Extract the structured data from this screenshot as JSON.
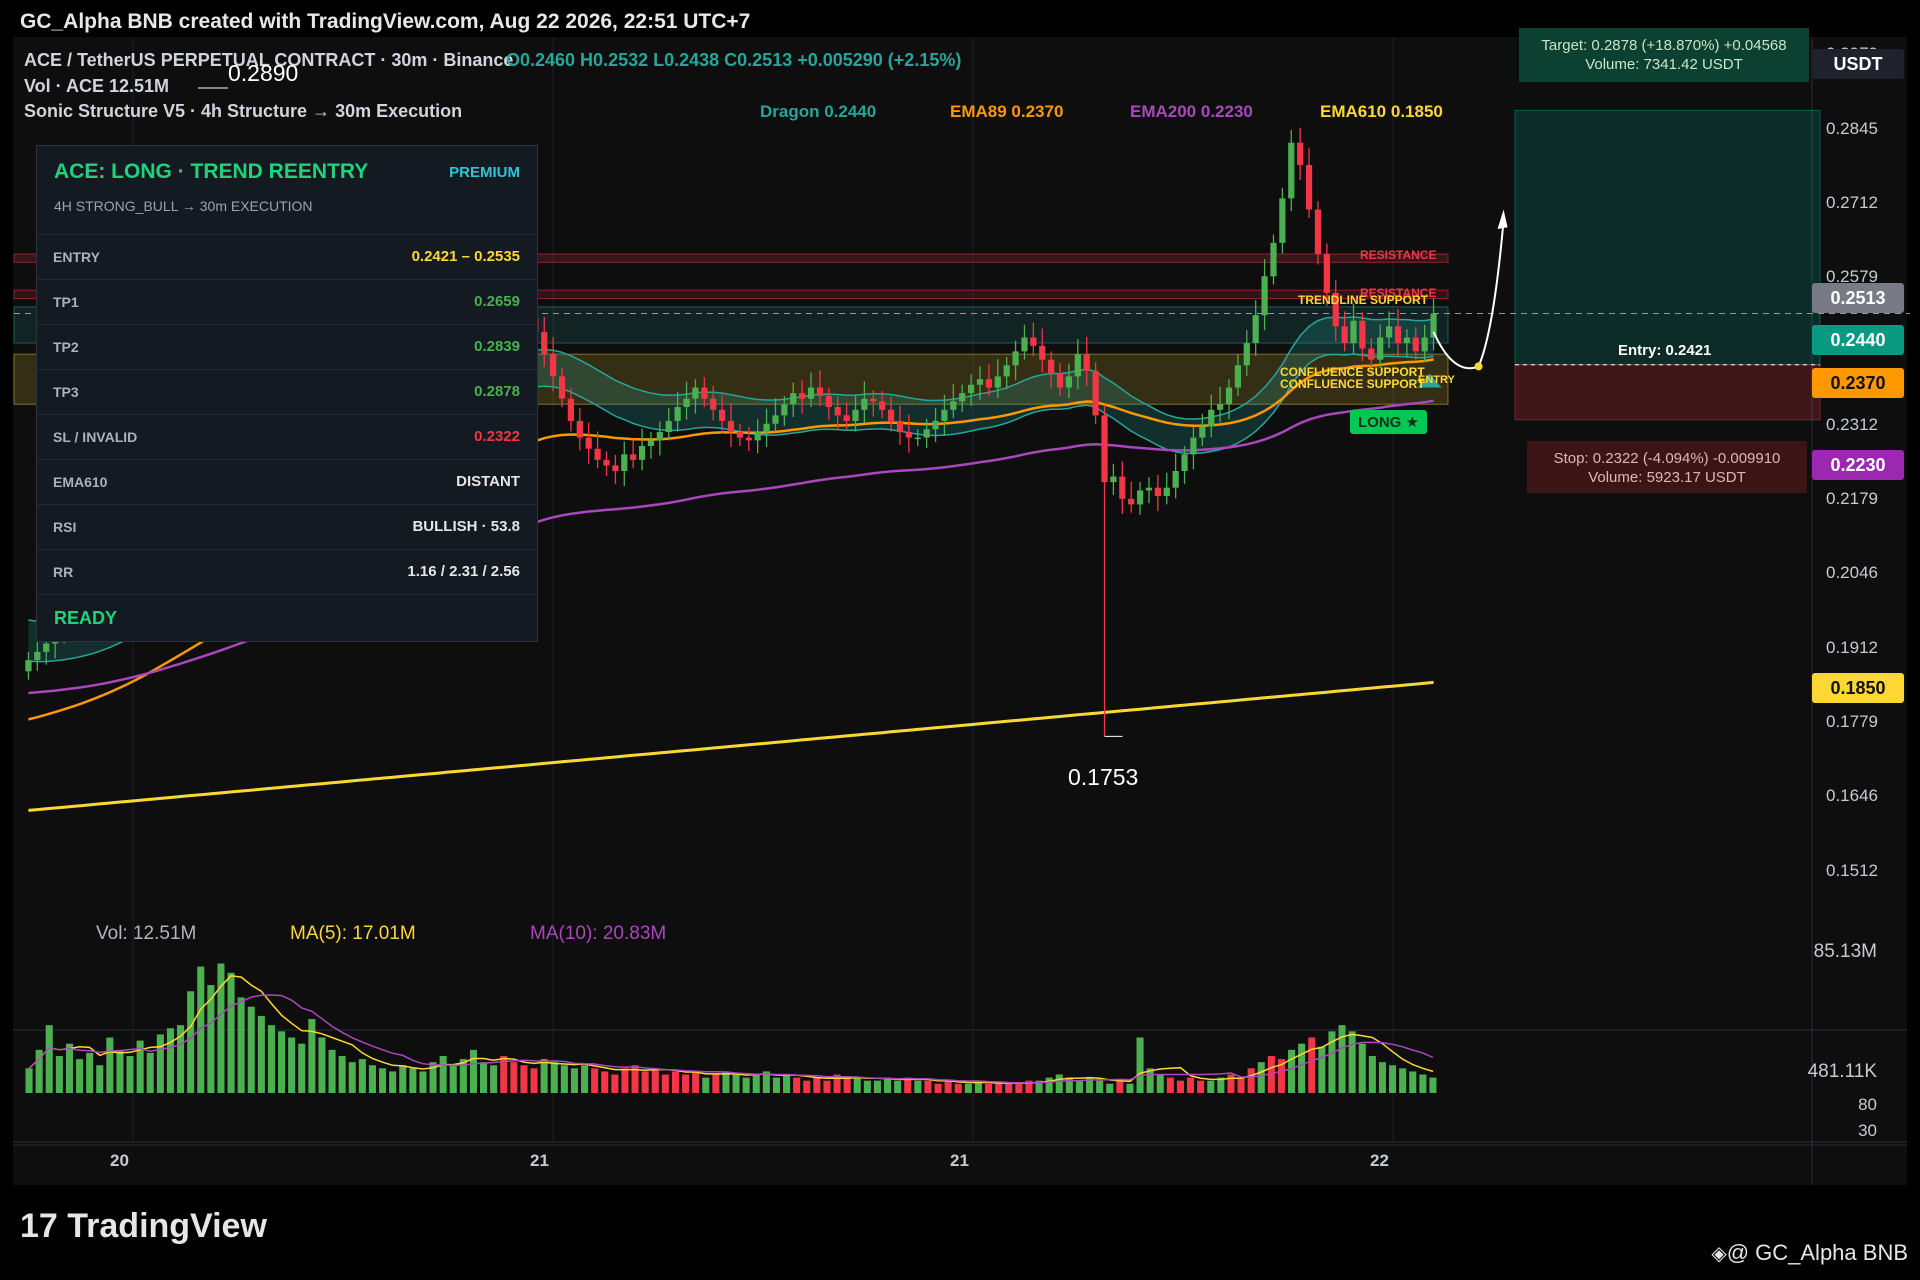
{
  "header": {
    "title": "GC_Alpha BNB created with TradingView.com, Aug 22 2026, 22:51 UTC+7"
  },
  "legend": {
    "symbol": "ACE / TetherUS PERPETUAL CONTRACT · 30m · Binance",
    "ohlc": "O0.2460 H0.2532 L0.2438 C0.2513 +0.005290 (+2.15%)",
    "vol": "Vol · ACE  12.51M",
    "indicator": "Sonic Structure V5 · 4h Structure → 30m Execution"
  },
  "indicators": [
    {
      "label": "Dragon 0.2440",
      "color": "#26a69a"
    },
    {
      "label": "EMA89 0.2370",
      "color": "#ff9800"
    },
    {
      "label": "EMA200 0.2230",
      "color": "#ab47bc"
    },
    {
      "label": "EMA610 0.1850",
      "color": "#fdd835"
    }
  ],
  "panel": {
    "title": "ACE: LONG · TREND REENTRY",
    "badge": "PREMIUM",
    "subtitle": "4H STRONG_BULL → 30m EXECUTION",
    "rows": [
      {
        "key": "ENTRY",
        "value": "0.2421 – 0.2535",
        "color": "#fdd835"
      },
      {
        "key": "TP1",
        "value": "0.2659",
        "color": "#4caf50"
      },
      {
        "key": "TP2",
        "value": "0.2839",
        "color": "#4caf50"
      },
      {
        "key": "TP3",
        "value": "0.2878",
        "color": "#4caf50"
      },
      {
        "key": "SL / INVALID",
        "value": "0.2322",
        "color": "#f23645"
      },
      {
        "key": "EMA610",
        "value": "DISTANT",
        "color": "#e6e6e6"
      },
      {
        "key": "RSI",
        "value": "BULLISH · 53.8",
        "color": "#e6e6e6"
      },
      {
        "key": "RR",
        "value": "1.16 / 2.31 / 2.56",
        "color": "#e6e6e6"
      }
    ],
    "status": "READY"
  },
  "price_axis": {
    "ticks": [
      "0.2979",
      "0.2845",
      "0.2712",
      "0.2579",
      "0.2312",
      "0.2179",
      "0.2046",
      "0.1912",
      "0.1779",
      "0.1646",
      "0.1512"
    ],
    "tags": [
      {
        "label": "USDT",
        "bg": "#1e222d",
        "fg": "#ffffff"
      },
      {
        "label": "0.2513",
        "bg": "#787b86",
        "fg": "#ffffff"
      },
      {
        "label": "0.2440",
        "bg": "#089981",
        "fg": "#ffffff"
      },
      {
        "label": "0.2370",
        "bg": "#ff9800",
        "fg": "#111111"
      },
      {
        "label": "0.2230",
        "bg": "#9c27b0",
        "fg": "#ffffff"
      },
      {
        "label": "0.1850",
        "bg": "#fdd835",
        "fg": "#111111"
      }
    ]
  },
  "volume_axis": {
    "ticks": [
      "85.13M",
      "481.11K",
      "80",
      "30"
    ]
  },
  "volume_legend": {
    "vol": "Vol: 12.51M",
    "ma5": "MA(5): 17.01M",
    "ma10": "MA(10): 20.83M"
  },
  "time_axis": {
    "labels": [
      "20",
      "21",
      "21",
      "22"
    ]
  },
  "annotations": {
    "high": "0.2890",
    "low": "0.1753",
    "resistance1": "RESISTANCE",
    "resistance2": "RESISTANCE",
    "trendline_support": "TRENDLINE SUPPORT",
    "confluence1": "CONFLUENCE SUPPORT",
    "confluence2": "CONFLUENCE SUPPORT",
    "entry_tag": "ENTRY",
    "long_tag": "LONG ★",
    "entry_line": "Entry: 0.2421",
    "target_line1": "Target: 0.2878  (+18.870%)  +0.04568",
    "target_line2": "Volume: 7341.42 USDT",
    "stop_line1": "Stop: 0.2322  (-4.094%)  -0.009910",
    "stop_line2": "Volume: 5923.17 USDT"
  },
  "footer": {
    "brand": "TradingView",
    "credit": "@ GC_Alpha BNB"
  },
  "chart_data": {
    "type": "candlestick",
    "symbol": "ACE / TetherUS PERPETUAL CONTRACT",
    "timeframe": "30m",
    "last": {
      "open": 0.246,
      "high": 0.2532,
      "low": 0.2438,
      "close": 0.2513
    },
    "ylim": [
      0.145,
      0.301
    ],
    "close": [
      0.189,
      0.1905,
      0.192,
      0.1935,
      0.195,
      0.196,
      0.1975,
      0.199,
      0.201,
      0.203,
      0.205,
      0.207,
      0.209,
      0.211,
      0.213,
      0.215,
      0.2165,
      0.2175,
      0.219,
      0.22,
      0.221,
      0.2225,
      0.224,
      0.2255,
      0.227,
      0.2285,
      0.2295,
      0.2305,
      0.2315,
      0.2325,
      0.2335,
      0.2345,
      0.2355,
      0.2365,
      0.2375,
      0.2385,
      0.2395,
      0.2405,
      0.2415,
      0.2425,
      0.2435,
      0.2445,
      0.2455,
      0.247,
      0.249,
      0.2505,
      0.2525,
      0.25,
      0.248,
      0.2455,
      0.243,
      0.244,
      0.246,
      0.249,
      0.251,
      0.253,
      0.2505,
      0.248,
      0.244,
      0.24,
      0.236,
      0.232,
      0.229,
      0.227,
      0.225,
      0.224,
      0.223,
      0.226,
      0.225,
      0.2275,
      0.2285,
      0.23,
      0.232,
      0.2345,
      0.236,
      0.238,
      0.236,
      0.234,
      0.232,
      0.23,
      0.229,
      0.2285,
      0.23,
      0.2315,
      0.233,
      0.235,
      0.237,
      0.236,
      0.238,
      0.2365,
      0.2345,
      0.233,
      0.232,
      0.234,
      0.236,
      0.2355,
      0.234,
      0.232,
      0.23,
      0.229,
      0.229,
      0.2305,
      0.232,
      0.234,
      0.2355,
      0.237,
      0.2385,
      0.2395,
      0.238,
      0.24,
      0.242,
      0.2445,
      0.247,
      0.2455,
      0.243,
      0.2405,
      0.238,
      0.24,
      0.244,
      0.241,
      0.233,
      0.221,
      0.222,
      0.218,
      0.217,
      0.2195,
      0.22,
      0.2185,
      0.22,
      0.223,
      0.226,
      0.229,
      0.231,
      0.234,
      0.235,
      0.238,
      0.242,
      0.246,
      0.251,
      0.258,
      0.264,
      0.272,
      0.282,
      0.278,
      0.27,
      0.262,
      0.255,
      0.249,
      0.246,
      0.25,
      0.245,
      0.243,
      0.247,
      0.249,
      0.246,
      0.247,
      0.2445,
      0.247,
      0.2513
    ],
    "volume_M": [
      8,
      14,
      22,
      12,
      16,
      11,
      13,
      9,
      18,
      14,
      12,
      17,
      13,
      19,
      21,
      22,
      33,
      41,
      35,
      42,
      39,
      31,
      28,
      25,
      22,
      20,
      18,
      16,
      24,
      18,
      14,
      12,
      10,
      11,
      9,
      8,
      7,
      9,
      8,
      7,
      10,
      12,
      9,
      11,
      14,
      10,
      9,
      12,
      10,
      9,
      8,
      11,
      10,
      9,
      8,
      9,
      8,
      7,
      6,
      8,
      9,
      7,
      8,
      6,
      7,
      6,
      7,
      5,
      6,
      7,
      6,
      5,
      6,
      7,
      5,
      6,
      5,
      4,
      5,
      4,
      6,
      5,
      5,
      4,
      4,
      5,
      4,
      5,
      4,
      4,
      3,
      4,
      3,
      3,
      4,
      3,
      3,
      3,
      3,
      4,
      4,
      5,
      6,
      5,
      4,
      5,
      4,
      3,
      4,
      3,
      18,
      8,
      6,
      5,
      4,
      5,
      4,
      4,
      5,
      6,
      5,
      8,
      10,
      12,
      11,
      14,
      16,
      18,
      15,
      20,
      22,
      20,
      16,
      12,
      10,
      9,
      8,
      7,
      6,
      5
    ],
    "ema_dragon_last": 0.244,
    "ema89_last": 0.237,
    "ema200_last": 0.223,
    "ema610_last": 0.185,
    "entry": 0.2421,
    "target": 0.2878,
    "stop": 0.2322,
    "swing_high": 0.289,
    "swing_low": 0.1753
  }
}
